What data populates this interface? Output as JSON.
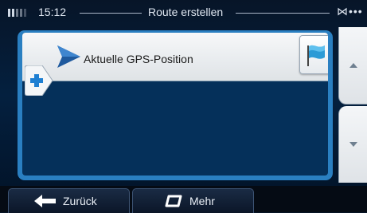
{
  "status": {
    "time": "15:12",
    "title": "Route erstellen",
    "sat_indicator": "⋈•••"
  },
  "route": {
    "items": [
      {
        "label": "Aktuelle GPS-Position",
        "icon": "navigation-arrow-icon"
      }
    ],
    "add_icon": "plus-icon",
    "flag_icon": "flag-icon"
  },
  "scroll": {
    "up_icon": "triangle-up-icon",
    "down_icon": "triangle-down-icon"
  },
  "bottom": {
    "back_label": "Zurück",
    "more_label": "Mehr"
  },
  "colors": {
    "accent": "#2a7fc1",
    "plus": "#1e7fd2"
  }
}
